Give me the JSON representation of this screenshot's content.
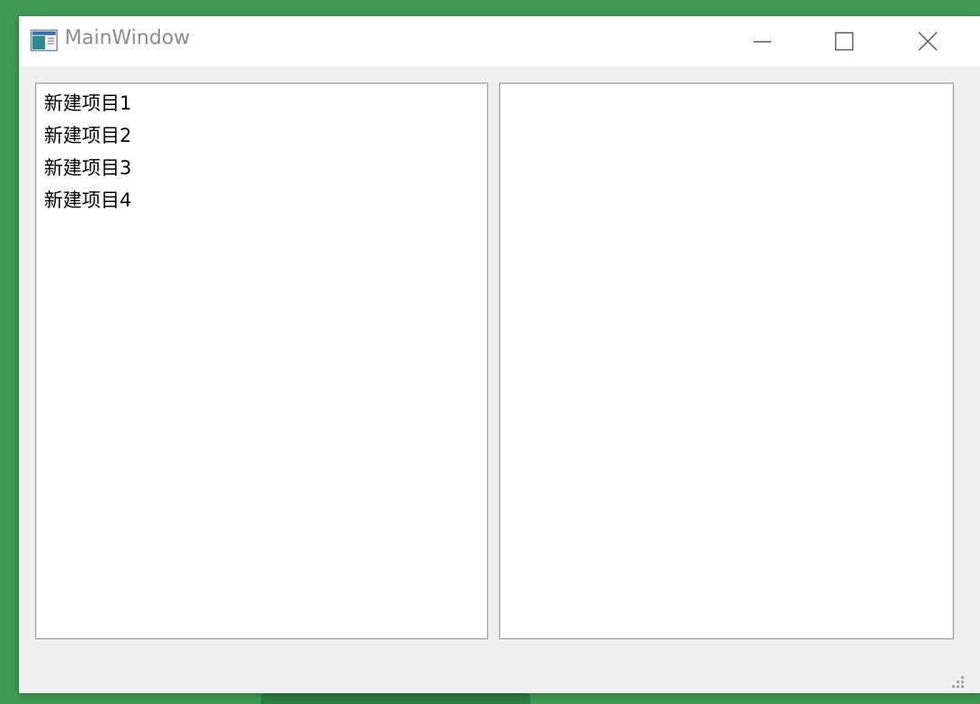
{
  "window": {
    "title": "MainWindow",
    "icons": {
      "app": "app-window-icon",
      "minimize": "minimize-icon",
      "maximize": "maximize-icon",
      "close": "close-icon",
      "resize": "resize-grip-icon"
    }
  },
  "left_list": {
    "items": [
      {
        "label": "新建项目1"
      },
      {
        "label": "新建项目2"
      },
      {
        "label": "新建项目3"
      },
      {
        "label": "新建项目4"
      }
    ]
  },
  "right_list": {
    "items": []
  },
  "colors": {
    "desktop": "#3f9a55",
    "window_bg": "#f0f0f0",
    "title_text": "#8c8c8c",
    "list_border": "#a0a0a0"
  }
}
